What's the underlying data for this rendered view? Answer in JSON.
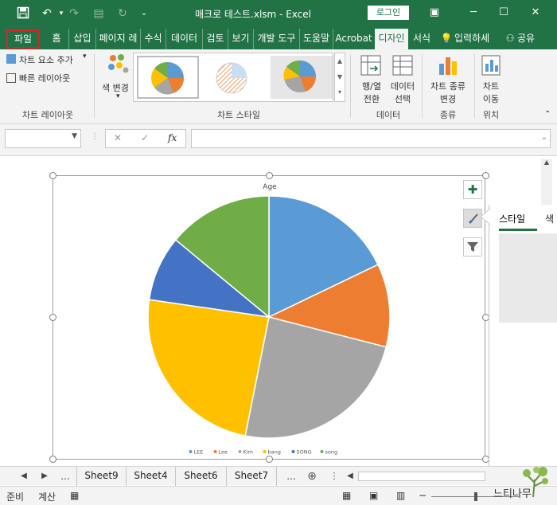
{
  "window": {
    "title": "매크로 테스트.xlsm  -  Excel",
    "login_label": "로그인"
  },
  "tabs": [
    "파일",
    "홈",
    "삽입",
    "페이지 레",
    "수식",
    "데이터",
    "검토",
    "보기",
    "개발 도구",
    "도움말",
    "Acrobat",
    "디자인",
    "서식"
  ],
  "tell_me": "입력하세",
  "share": "공유",
  "ribbon": {
    "add_element": "차트 요소 추가",
    "quick_layout": "빠른 레이아웃",
    "layout_group": "차트 레이아웃",
    "change_color": "색 변경",
    "styles_group": "차트 스타일",
    "switch_row_col": [
      "행/열",
      "전환"
    ],
    "select_data": [
      "데이터",
      "선택"
    ],
    "data_group": "데이터",
    "change_type": [
      "차트 종류",
      "변경"
    ],
    "type_group": "종류",
    "move_chart": [
      "차트",
      "이동"
    ],
    "location_group": "위치"
  },
  "formula": {
    "fx_label": "fx",
    "value": ""
  },
  "chart_data": {
    "type": "pie",
    "title": "Age",
    "categories": [
      "LEE",
      "Lee",
      "Kim",
      "bang",
      "SONG",
      "song"
    ],
    "values": [
      18.5,
      11.5,
      25,
      25,
      9,
      14.5
    ],
    "colors": [
      "#5b9bd5",
      "#ed7d31",
      "#a5a5a5",
      "#ffc000",
      "#4472c4",
      "#70ad47"
    ],
    "legend_position": "bottom"
  },
  "side_panel": {
    "add_icon": "plus-icon",
    "style_icon": "brush-icon",
    "filter_icon": "filter-icon",
    "tab_style": "스타일",
    "tab_color": "색"
  },
  "sheets": [
    "Sheet9",
    "Sheet4",
    "Sheet6",
    "Sheet7"
  ],
  "sheet_more": "...",
  "status": {
    "ready": "준비",
    "calc": "계산"
  }
}
